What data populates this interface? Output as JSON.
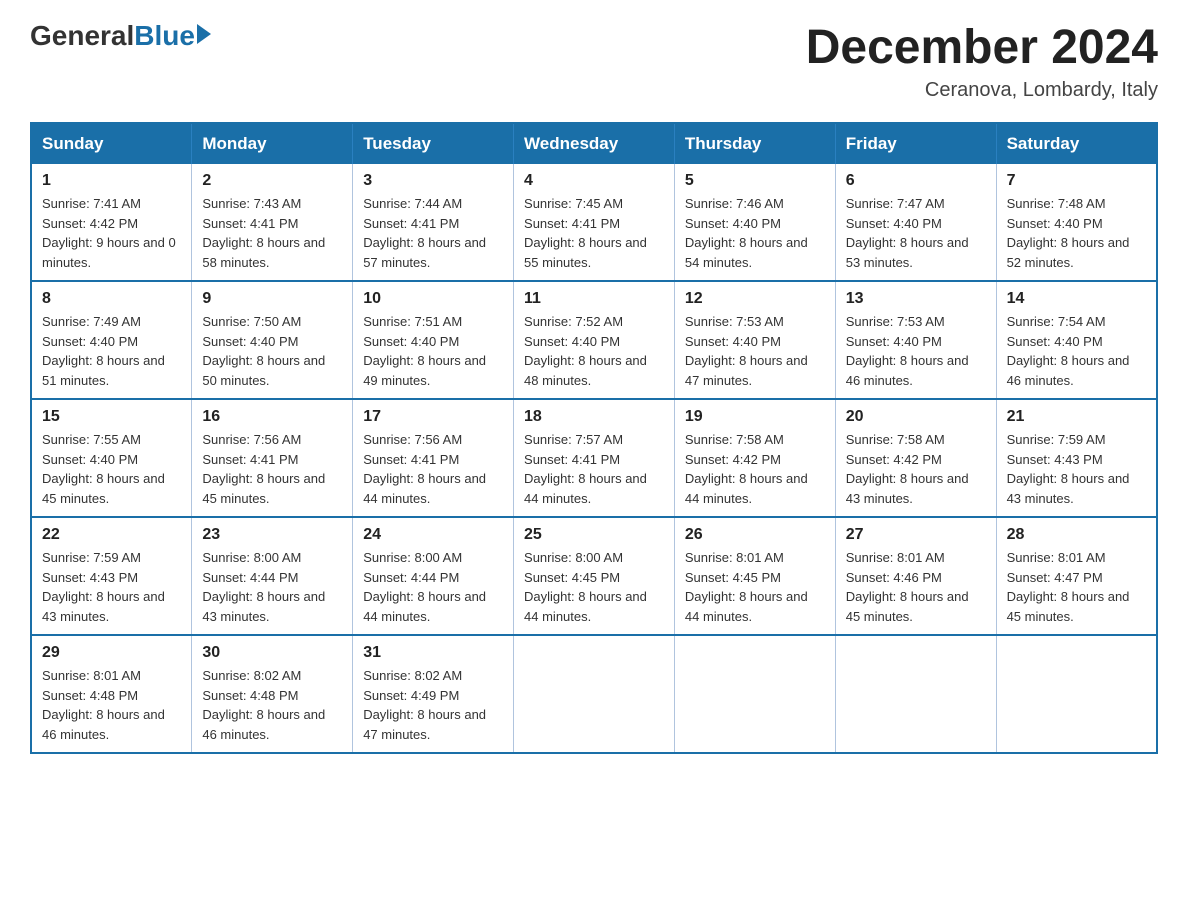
{
  "logo": {
    "general": "General",
    "blue": "Blue"
  },
  "header": {
    "month_title": "December 2024",
    "location": "Ceranova, Lombardy, Italy"
  },
  "days_of_week": [
    "Sunday",
    "Monday",
    "Tuesday",
    "Wednesday",
    "Thursday",
    "Friday",
    "Saturday"
  ],
  "weeks": [
    [
      {
        "day": "1",
        "sunrise": "7:41 AM",
        "sunset": "4:42 PM",
        "daylight": "9 hours and 0 minutes."
      },
      {
        "day": "2",
        "sunrise": "7:43 AM",
        "sunset": "4:41 PM",
        "daylight": "8 hours and 58 minutes."
      },
      {
        "day": "3",
        "sunrise": "7:44 AM",
        "sunset": "4:41 PM",
        "daylight": "8 hours and 57 minutes."
      },
      {
        "day": "4",
        "sunrise": "7:45 AM",
        "sunset": "4:41 PM",
        "daylight": "8 hours and 55 minutes."
      },
      {
        "day": "5",
        "sunrise": "7:46 AM",
        "sunset": "4:40 PM",
        "daylight": "8 hours and 54 minutes."
      },
      {
        "day": "6",
        "sunrise": "7:47 AM",
        "sunset": "4:40 PM",
        "daylight": "8 hours and 53 minutes."
      },
      {
        "day": "7",
        "sunrise": "7:48 AM",
        "sunset": "4:40 PM",
        "daylight": "8 hours and 52 minutes."
      }
    ],
    [
      {
        "day": "8",
        "sunrise": "7:49 AM",
        "sunset": "4:40 PM",
        "daylight": "8 hours and 51 minutes."
      },
      {
        "day": "9",
        "sunrise": "7:50 AM",
        "sunset": "4:40 PM",
        "daylight": "8 hours and 50 minutes."
      },
      {
        "day": "10",
        "sunrise": "7:51 AM",
        "sunset": "4:40 PM",
        "daylight": "8 hours and 49 minutes."
      },
      {
        "day": "11",
        "sunrise": "7:52 AM",
        "sunset": "4:40 PM",
        "daylight": "8 hours and 48 minutes."
      },
      {
        "day": "12",
        "sunrise": "7:53 AM",
        "sunset": "4:40 PM",
        "daylight": "8 hours and 47 minutes."
      },
      {
        "day": "13",
        "sunrise": "7:53 AM",
        "sunset": "4:40 PM",
        "daylight": "8 hours and 46 minutes."
      },
      {
        "day": "14",
        "sunrise": "7:54 AM",
        "sunset": "4:40 PM",
        "daylight": "8 hours and 46 minutes."
      }
    ],
    [
      {
        "day": "15",
        "sunrise": "7:55 AM",
        "sunset": "4:40 PM",
        "daylight": "8 hours and 45 minutes."
      },
      {
        "day": "16",
        "sunrise": "7:56 AM",
        "sunset": "4:41 PM",
        "daylight": "8 hours and 45 minutes."
      },
      {
        "day": "17",
        "sunrise": "7:56 AM",
        "sunset": "4:41 PM",
        "daylight": "8 hours and 44 minutes."
      },
      {
        "day": "18",
        "sunrise": "7:57 AM",
        "sunset": "4:41 PM",
        "daylight": "8 hours and 44 minutes."
      },
      {
        "day": "19",
        "sunrise": "7:58 AM",
        "sunset": "4:42 PM",
        "daylight": "8 hours and 44 minutes."
      },
      {
        "day": "20",
        "sunrise": "7:58 AM",
        "sunset": "4:42 PM",
        "daylight": "8 hours and 43 minutes."
      },
      {
        "day": "21",
        "sunrise": "7:59 AM",
        "sunset": "4:43 PM",
        "daylight": "8 hours and 43 minutes."
      }
    ],
    [
      {
        "day": "22",
        "sunrise": "7:59 AM",
        "sunset": "4:43 PM",
        "daylight": "8 hours and 43 minutes."
      },
      {
        "day": "23",
        "sunrise": "8:00 AM",
        "sunset": "4:44 PM",
        "daylight": "8 hours and 43 minutes."
      },
      {
        "day": "24",
        "sunrise": "8:00 AM",
        "sunset": "4:44 PM",
        "daylight": "8 hours and 44 minutes."
      },
      {
        "day": "25",
        "sunrise": "8:00 AM",
        "sunset": "4:45 PM",
        "daylight": "8 hours and 44 minutes."
      },
      {
        "day": "26",
        "sunrise": "8:01 AM",
        "sunset": "4:45 PM",
        "daylight": "8 hours and 44 minutes."
      },
      {
        "day": "27",
        "sunrise": "8:01 AM",
        "sunset": "4:46 PM",
        "daylight": "8 hours and 45 minutes."
      },
      {
        "day": "28",
        "sunrise": "8:01 AM",
        "sunset": "4:47 PM",
        "daylight": "8 hours and 45 minutes."
      }
    ],
    [
      {
        "day": "29",
        "sunrise": "8:01 AM",
        "sunset": "4:48 PM",
        "daylight": "8 hours and 46 minutes."
      },
      {
        "day": "30",
        "sunrise": "8:02 AM",
        "sunset": "4:48 PM",
        "daylight": "8 hours and 46 minutes."
      },
      {
        "day": "31",
        "sunrise": "8:02 AM",
        "sunset": "4:49 PM",
        "daylight": "8 hours and 47 minutes."
      },
      null,
      null,
      null,
      null
    ]
  ]
}
